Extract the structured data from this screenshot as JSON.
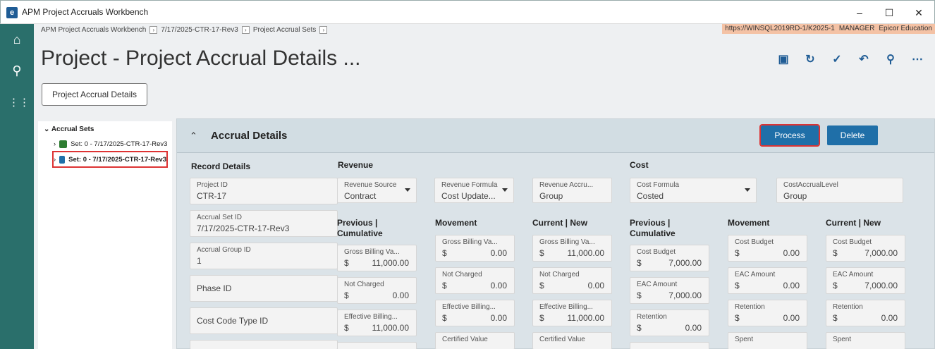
{
  "window": {
    "title": "APM Project Accruals Workbench",
    "minimize": "–",
    "maximize": "☐",
    "close": "✕",
    "app_icon": "e"
  },
  "breadcrumbs": [
    "APM Project Accruals Workbench",
    "7/17/2025-CTR-17-Rev3",
    "Project Accrual Sets"
  ],
  "crumb_sep": "›",
  "connection": {
    "url": "https://WINSQL2019RD-1/K2025-1",
    "user": "MANAGER",
    "company": "Epicor Education"
  },
  "page_title": "Project - Project Accrual Details ...",
  "tab_button": "Project Accrual Details",
  "nav_icons": [
    "home-icon",
    "search-icon",
    "apps-icon"
  ],
  "toolbar_icons": [
    "save-icon",
    "refresh-icon",
    "clear-icon",
    "undo-icon",
    "search-icon",
    "more-icon"
  ],
  "tree": {
    "root": "Accrual Sets",
    "items": [
      "Set: 0 - 7/17/2025-CTR-17-Rev3",
      "Set: 0 - 7/17/2025-CTR-17-Rev3"
    ]
  },
  "panel": {
    "title": "Accrual Details",
    "process": "Process",
    "delete": "Delete",
    "record_details": "Record Details",
    "revenue": "Revenue",
    "cost": "Cost",
    "fields": {
      "project_id": {
        "label": "Project ID",
        "value": "CTR-17"
      },
      "accrual_set_id": {
        "label": "Accrual Set ID",
        "value": "7/17/2025-CTR-17-Rev3"
      },
      "accrual_group_id": {
        "label": "Accrual Group ID",
        "value": "1"
      },
      "phase_id": {
        "label": "Phase ID"
      },
      "cost_code_type_id": {
        "label": "Cost Code Type ID"
      },
      "revenue_source": {
        "label": "Revenue Source",
        "value": "Contract"
      },
      "revenue_formula": {
        "label": "Revenue Formula",
        "value": "Cost Update..."
      },
      "revenue_accrual": {
        "label": "Revenue Accru...",
        "value": "Group"
      },
      "cost_formula": {
        "label": "Cost Formula",
        "value": "Costed"
      },
      "cost_accrual_level": {
        "label": "CostAccrualLevel",
        "value": "Group"
      }
    },
    "columns": {
      "prev": "Previous | Cumulative",
      "movement": "Movement",
      "current": "Current | New"
    },
    "currency": "$",
    "revenue_grid": {
      "prev": [
        {
          "label": "Gross Billing Va...",
          "value": "11,000.00"
        },
        {
          "label": "Not Charged",
          "value": "0.00"
        },
        {
          "label": "Effective Billing...",
          "value": "11,000.00"
        }
      ],
      "movement": [
        {
          "label": "Gross Billing Va...",
          "value": "0.00"
        },
        {
          "label": "Not Charged",
          "value": "0.00"
        },
        {
          "label": "Effective Billing...",
          "value": "0.00"
        },
        {
          "label": "Certified Value",
          "value": ""
        }
      ],
      "current": [
        {
          "label": "Gross Billing Va...",
          "value": "11,000.00"
        },
        {
          "label": "Not Charged",
          "value": "0.00"
        },
        {
          "label": "Effective Billing...",
          "value": "11,000.00"
        },
        {
          "label": "Certified Value",
          "value": ""
        }
      ]
    },
    "cost_grid": {
      "prev": [
        {
          "label": "Cost Budget",
          "value": "7,000.00"
        },
        {
          "label": "EAC Amount",
          "value": "7,000.00"
        },
        {
          "label": "Retention",
          "value": "0.00"
        }
      ],
      "movement": [
        {
          "label": "Cost Budget",
          "value": "0.00"
        },
        {
          "label": "EAC Amount",
          "value": "0.00"
        },
        {
          "label": "Retention",
          "value": "0.00"
        },
        {
          "label": "Spent",
          "value": ""
        }
      ],
      "current": [
        {
          "label": "Cost Budget",
          "value": "7,000.00"
        },
        {
          "label": "EAC Amount",
          "value": "7,000.00"
        },
        {
          "label": "Retention",
          "value": "0.00"
        },
        {
          "label": "Spent",
          "value": ""
        }
      ]
    }
  }
}
